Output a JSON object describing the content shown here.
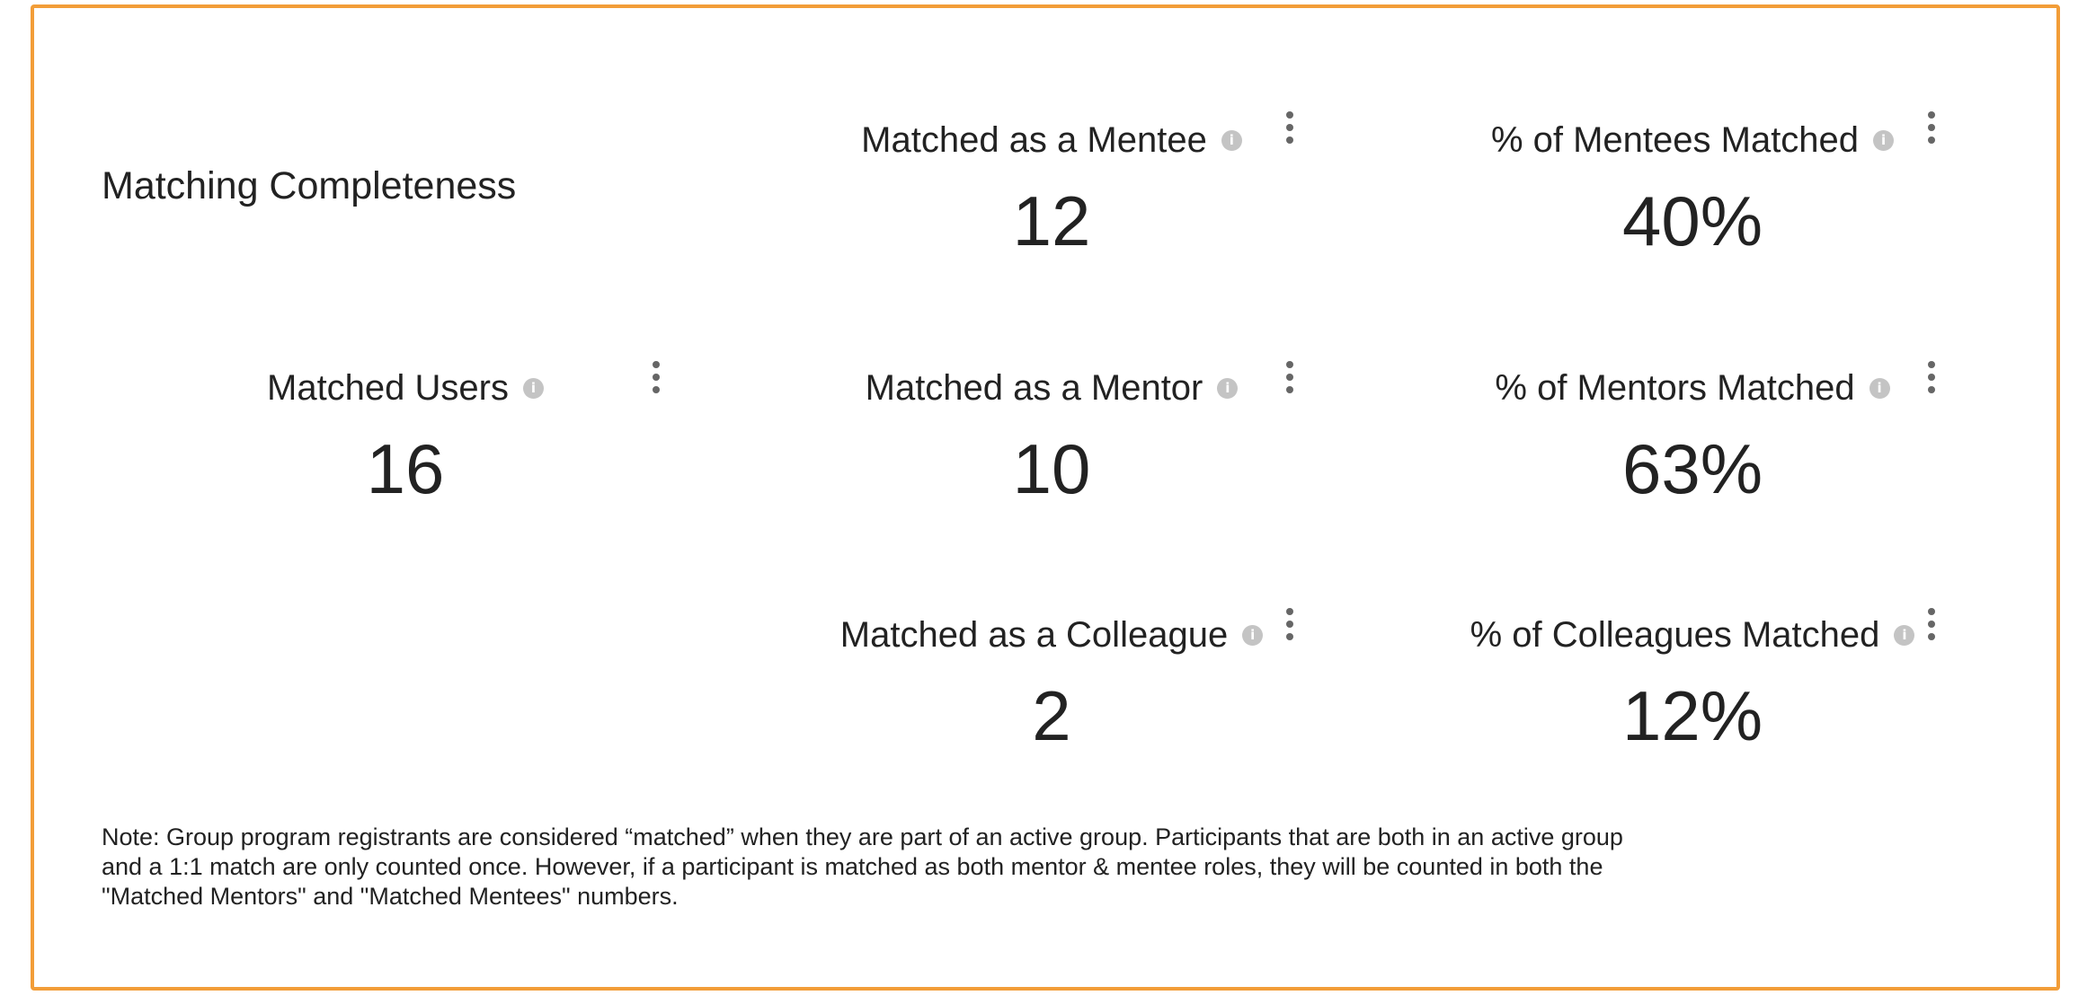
{
  "section": {
    "title": "Matching Completeness"
  },
  "metrics": {
    "matched_users": {
      "label": "Matched Users",
      "value": "16"
    },
    "matched_mentee": {
      "label": "Matched as a Mentee",
      "value": "12"
    },
    "matched_mentor": {
      "label": "Matched as a Mentor",
      "value": "10"
    },
    "matched_colleague": {
      "label": "Matched as a Colleague",
      "value": "2"
    },
    "pct_mentees": {
      "label": "% of Mentees Matched",
      "value": "40%"
    },
    "pct_mentors": {
      "label": "% of Mentors Matched",
      "value": "63%"
    },
    "pct_colleagues": {
      "label": "% of Colleagues Matched",
      "value": "12%"
    }
  },
  "icons": {
    "info": "info-icon",
    "menu": "kebab-menu-icon"
  },
  "note": {
    "text": "Note: Group program registrants are considered “matched” when they are part of an active group. Participants that are both in an active group and a 1:1 match are only counted once. However, if a participant is matched as both mentor & mentee roles, they will be counted in both the \"Matched Mentors\" and \"Matched Mentees\" numbers."
  },
  "colors": {
    "border_accent": "#f29d38",
    "text": "#222222",
    "info_icon": "#c4c4c4",
    "menu_icon": "#666666"
  }
}
